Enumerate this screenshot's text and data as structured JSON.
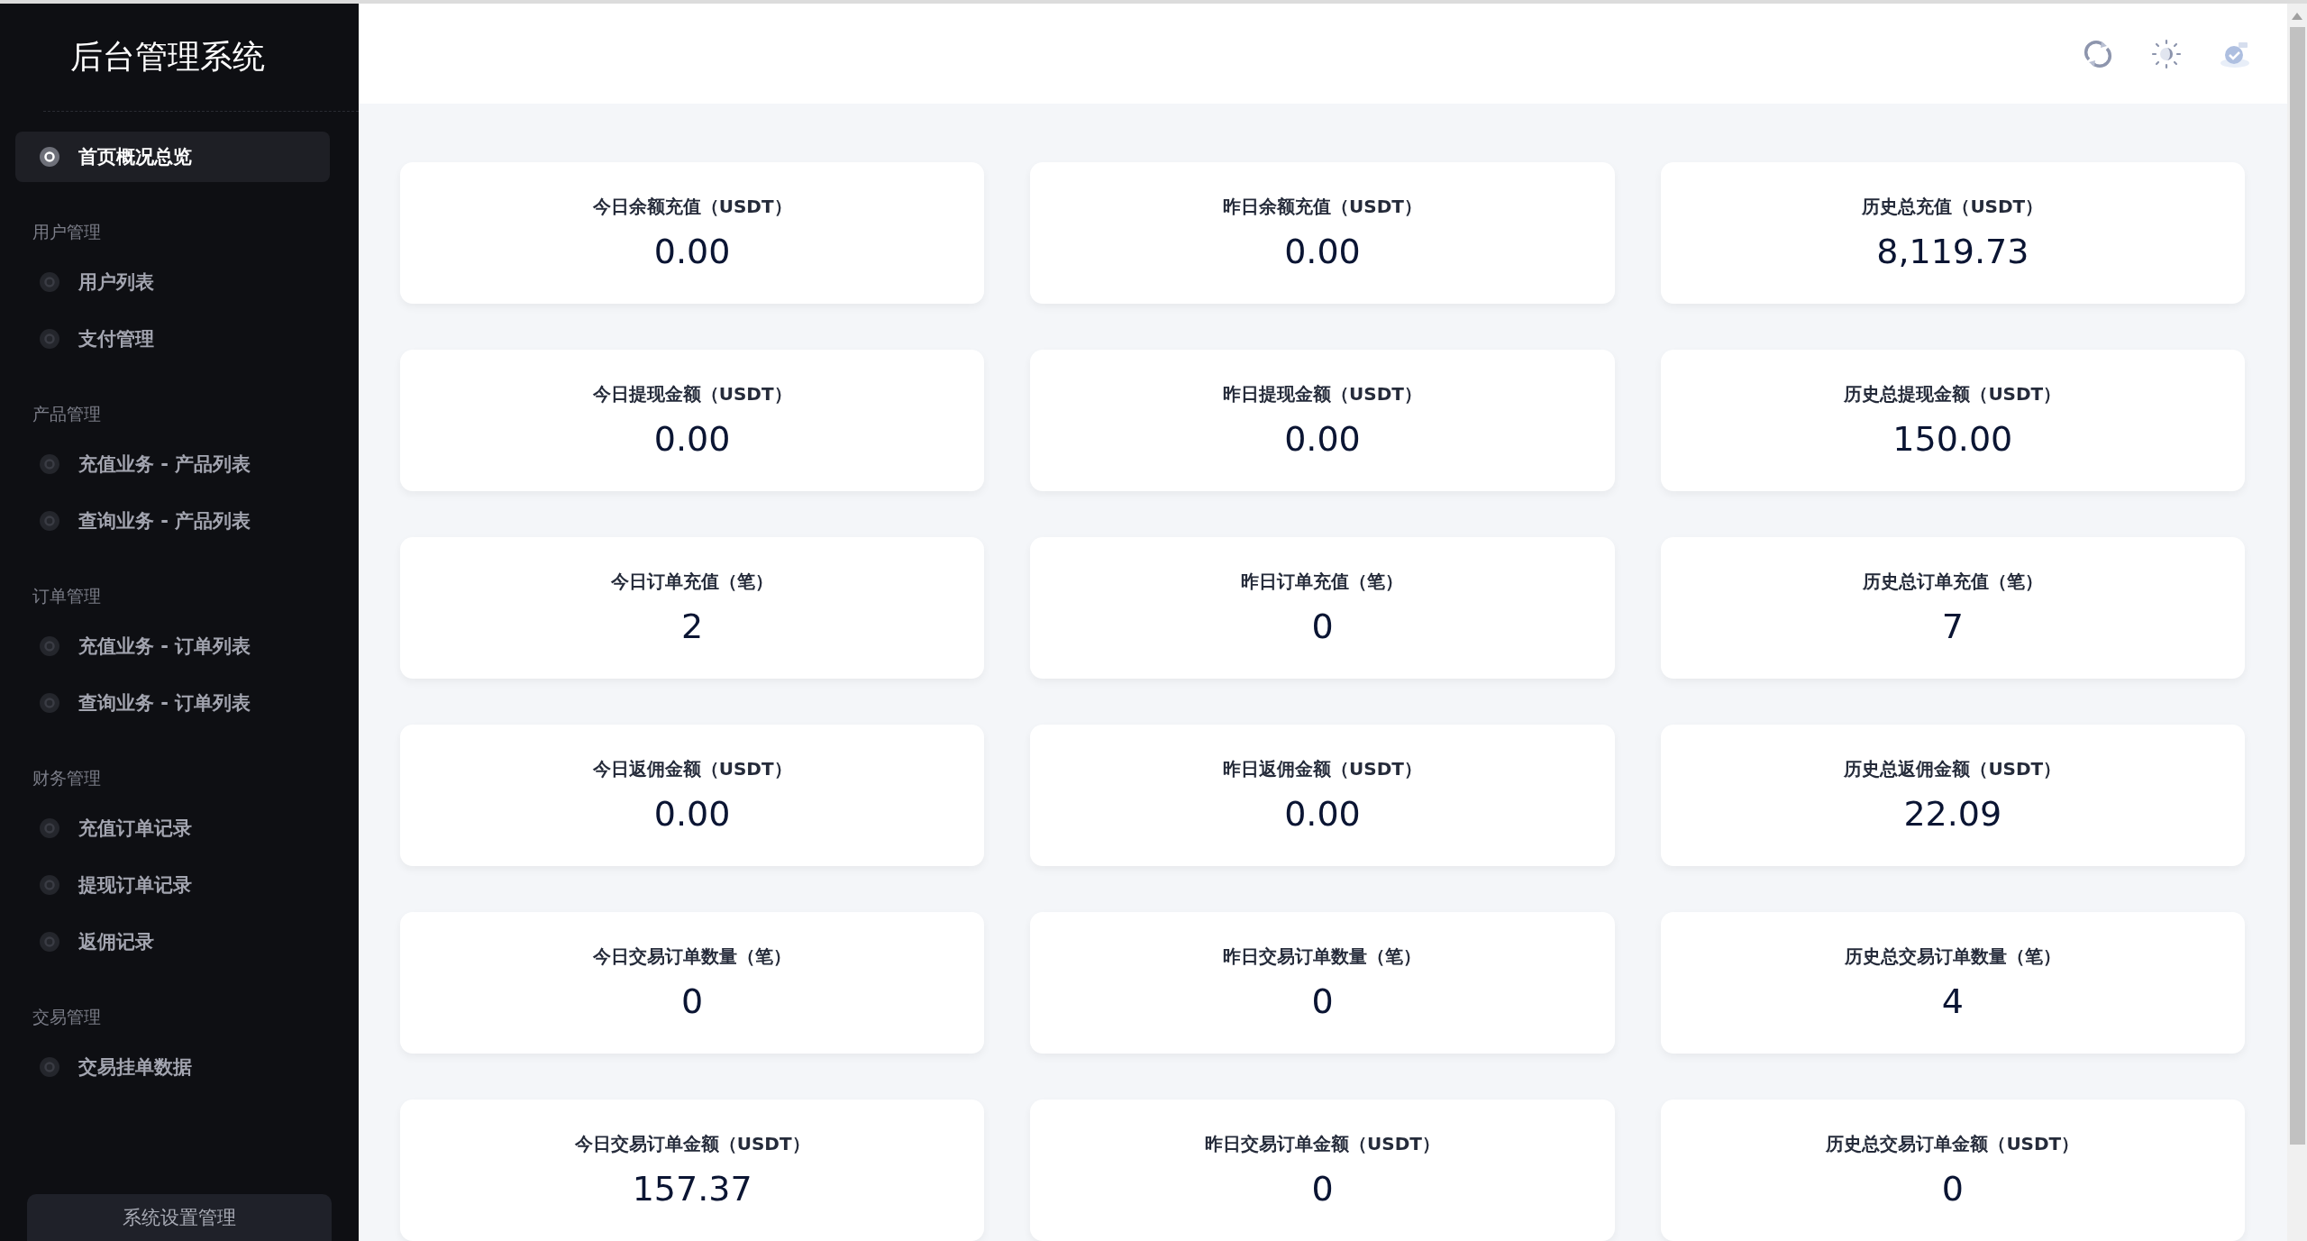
{
  "sidebar": {
    "title": "后台管理系统",
    "items": [
      {
        "kind": "item",
        "label": "首页概况总览",
        "selected": true
      },
      {
        "kind": "group",
        "label": "用户管理"
      },
      {
        "kind": "item",
        "label": "用户列表",
        "selected": false
      },
      {
        "kind": "item",
        "label": "支付管理",
        "selected": false
      },
      {
        "kind": "group",
        "label": "产品管理"
      },
      {
        "kind": "item",
        "label": "充值业务 - 产品列表",
        "selected": false
      },
      {
        "kind": "item",
        "label": "查询业务 - 产品列表",
        "selected": false
      },
      {
        "kind": "group",
        "label": "订单管理"
      },
      {
        "kind": "item",
        "label": "充值业务 - 订单列表",
        "selected": false
      },
      {
        "kind": "item",
        "label": "查询业务 - 订单列表",
        "selected": false
      },
      {
        "kind": "group",
        "label": "财务管理"
      },
      {
        "kind": "item",
        "label": "充值订单记录",
        "selected": false
      },
      {
        "kind": "item",
        "label": "提现订单记录",
        "selected": false
      },
      {
        "kind": "item",
        "label": "返佣记录",
        "selected": false
      },
      {
        "kind": "group",
        "label": "交易管理"
      },
      {
        "kind": "item",
        "label": "交易挂单数据",
        "selected": false
      }
    ],
    "footer_button": "系统设置管理"
  },
  "cards": [
    {
      "label": "今日余额充值（USDT）",
      "value": "0.00"
    },
    {
      "label": "昨日余额充值（USDT）",
      "value": "0.00"
    },
    {
      "label": "历史总充值（USDT）",
      "value": "8,119.73"
    },
    {
      "label": "今日提现金额（USDT）",
      "value": "0.00"
    },
    {
      "label": "昨日提现金额（USDT）",
      "value": "0.00"
    },
    {
      "label": "历史总提现金额（USDT）",
      "value": "150.00"
    },
    {
      "label": "今日订单充值（笔）",
      "value": "2"
    },
    {
      "label": "昨日订单充值（笔）",
      "value": "0"
    },
    {
      "label": "历史总订单充值（笔）",
      "value": "7"
    },
    {
      "label": "今日返佣金额（USDT）",
      "value": "0.00"
    },
    {
      "label": "昨日返佣金额（USDT）",
      "value": "0.00"
    },
    {
      "label": "历史总返佣金额（USDT）",
      "value": "22.09"
    },
    {
      "label": "今日交易订单数量（笔）",
      "value": "0"
    },
    {
      "label": "昨日交易订单数量（笔）",
      "value": "0"
    },
    {
      "label": "历史总交易订单数量（笔）",
      "value": "4"
    },
    {
      "label": "今日交易订单金额（USDT）",
      "value": "157.37"
    },
    {
      "label": "昨日交易订单金额（USDT）",
      "value": "0"
    },
    {
      "label": "历史总交易订单金额（USDT）",
      "value": "0"
    }
  ]
}
